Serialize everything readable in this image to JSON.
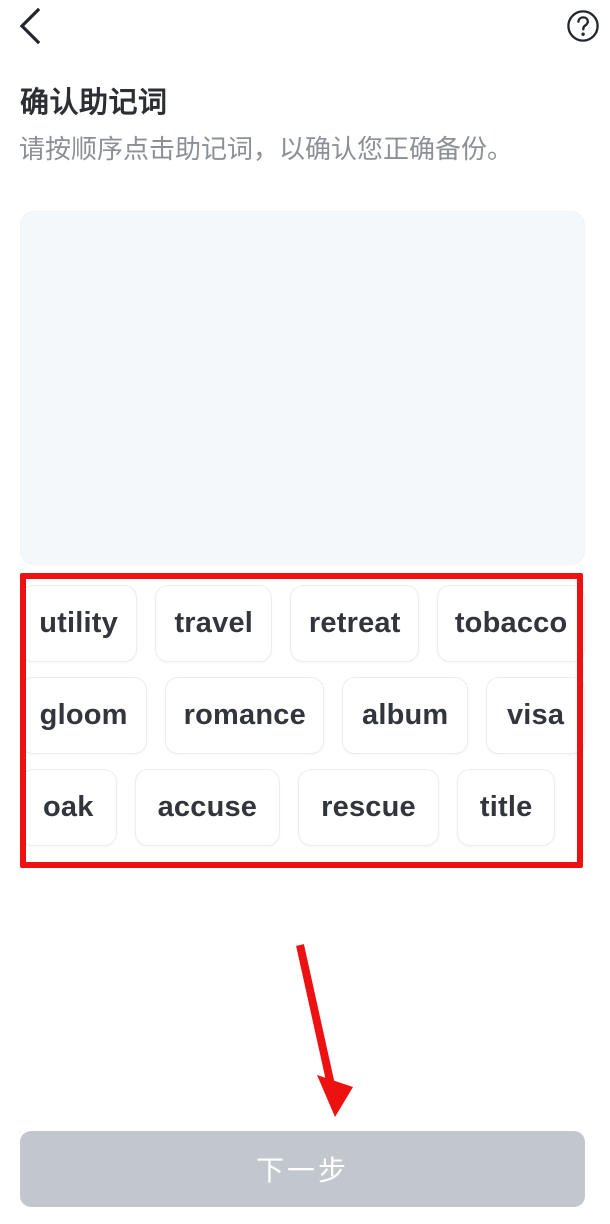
{
  "topbar": {
    "back_icon": "chevron-left-icon",
    "help_icon": "question-circle-icon"
  },
  "header": {
    "title": "确认助记词",
    "subtitle": "请按顺序点击助记词，以确认您正确备份。"
  },
  "dropzone": {
    "selected_words": []
  },
  "word_pool": {
    "rows": [
      [
        "utility",
        "travel",
        "retreat",
        "tobacco"
      ],
      [
        "gloom",
        "romance",
        "album",
        "visa"
      ],
      [
        "oak",
        "accuse",
        "rescue",
        "title"
      ]
    ]
  },
  "annotations": {
    "box_color": "#ee1111",
    "arrow_color": "#ee1111"
  },
  "footer": {
    "next_label": "下一步",
    "next_disabled_color": "#c2c7ce"
  }
}
